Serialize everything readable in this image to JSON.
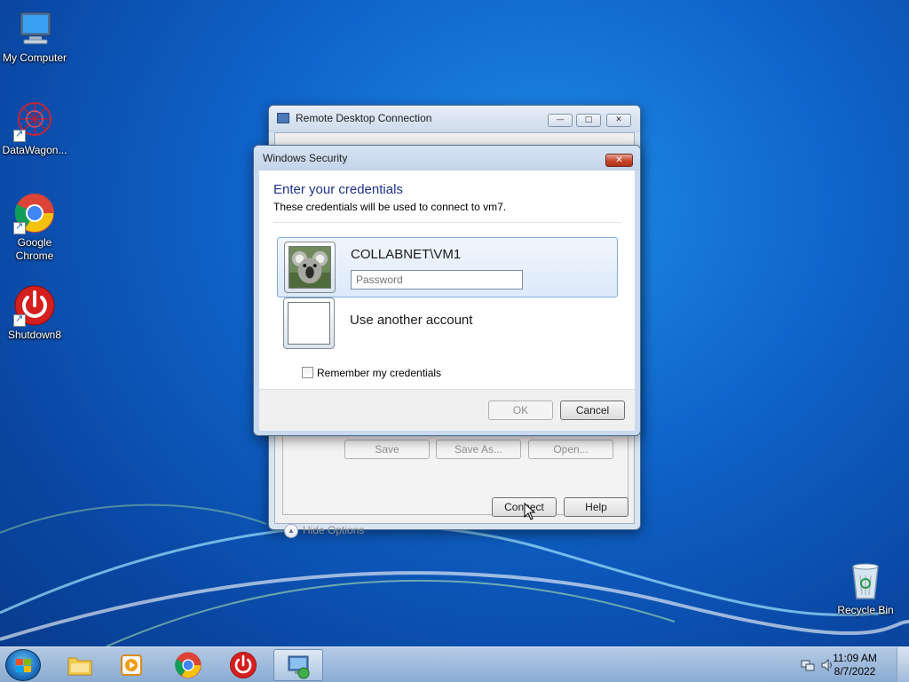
{
  "desktop": {
    "icons": [
      {
        "label": "My Computer"
      },
      {
        "label": "DataWagon..."
      },
      {
        "label": "Google Chrome"
      },
      {
        "label": "Shutdown8"
      },
      {
        "label": "Recycle Bin"
      }
    ]
  },
  "rdc_window": {
    "title": "Remote Desktop Connection",
    "save_label": "Save",
    "save_as_label": "Save As...",
    "open_label": "Open...",
    "hide_options_label": "Hide Options",
    "connect_label": "Connect",
    "help_label": "Help"
  },
  "security_dialog": {
    "title": "Windows Security",
    "heading": "Enter your credentials",
    "subtext": "These credentials will be used to connect to vm7.",
    "account_name": "COLLABNET\\VM1",
    "password_placeholder": "Password",
    "other_account_label": "Use another account",
    "remember_label": "Remember my credentials",
    "ok_label": "OK",
    "cancel_label": "Cancel"
  },
  "taskbar": {
    "time": "11:09 AM",
    "date": "8/7/2022"
  },
  "colors": {
    "accent": "#1e3287",
    "desktop": "#0f63c9",
    "close_button": "#c7452c"
  }
}
